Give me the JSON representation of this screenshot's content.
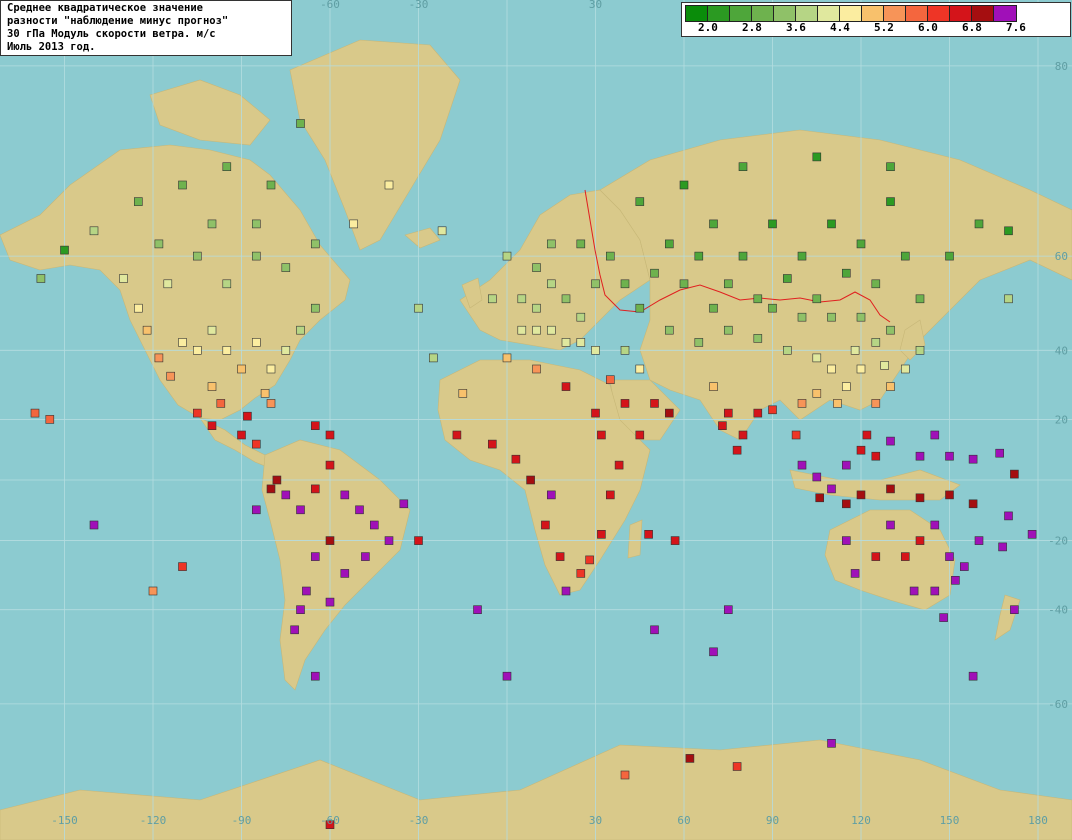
{
  "title": {
    "line1": "Среднее квадратическое значение",
    "line2": "разности \"наблюдение минус прогноз\"",
    "line3": "30 гПа Модуль скорости ветра. м/с",
    "line4": "Июль 2013 год."
  },
  "legend": {
    "colors": [
      "#0a8c0a",
      "#2b9a22",
      "#4ea63a",
      "#6eb24e",
      "#8fc168",
      "#b6d585",
      "#e0e89e",
      "#fbeda0",
      "#f8c16c",
      "#f79458",
      "#f4663e",
      "#ee3526",
      "#d4141a",
      "#a50e10",
      "#a010b8"
    ],
    "labels": [
      "2.0",
      "2.8",
      "3.6",
      "4.4",
      "5.2",
      "6.0",
      "6.8",
      "7.6"
    ]
  },
  "axis_labels": {
    "top_lon": [
      "-60",
      "-30",
      "30"
    ],
    "bottom_lon": [
      "-150",
      "-120",
      "-90",
      "-60",
      "-30",
      "30",
      "60",
      "90",
      "120",
      "150",
      "180"
    ],
    "right_lat": [
      "80",
      "60",
      "40",
      "20",
      "-20",
      "-40",
      "-60"
    ],
    "colors": {
      "ocean": "#8ccbd0",
      "land": "#d9c98a",
      "grid": "#b5dde0",
      "border": "#e02020"
    }
  },
  "stations": [
    {
      "lon": -158,
      "lat": 56,
      "c": 4
    },
    {
      "lon": -150,
      "lat": 61,
      "c": 1
    },
    {
      "lon": -140,
      "lat": 64,
      "c": 5
    },
    {
      "lon": -130,
      "lat": 56,
      "c": 6
    },
    {
      "lon": -125,
      "lat": 50,
      "c": 7
    },
    {
      "lon": -122,
      "lat": 45,
      "c": 8
    },
    {
      "lon": -118,
      "lat": 38,
      "c": 9
    },
    {
      "lon": -114,
      "lat": 33,
      "c": 9
    },
    {
      "lon": -110,
      "lat": 42,
      "c": 7
    },
    {
      "lon": -105,
      "lat": 40,
      "c": 7
    },
    {
      "lon": -100,
      "lat": 45,
      "c": 6
    },
    {
      "lon": -95,
      "lat": 40,
      "c": 7
    },
    {
      "lon": -90,
      "lat": 35,
      "c": 8
    },
    {
      "lon": -85,
      "lat": 42,
      "c": 7
    },
    {
      "lon": -80,
      "lat": 35,
      "c": 7
    },
    {
      "lon": -75,
      "lat": 40,
      "c": 6
    },
    {
      "lon": -70,
      "lat": 45,
      "c": 5
    },
    {
      "lon": -65,
      "lat": 50,
      "c": 4
    },
    {
      "lon": -95,
      "lat": 55,
      "c": 5
    },
    {
      "lon": -105,
      "lat": 60,
      "c": 4
    },
    {
      "lon": -85,
      "lat": 60,
      "c": 4
    },
    {
      "lon": -75,
      "lat": 58,
      "c": 4
    },
    {
      "lon": -115,
      "lat": 55,
      "c": 6
    },
    {
      "lon": -100,
      "lat": 30,
      "c": 8
    },
    {
      "lon": -97,
      "lat": 25,
      "c": 10
    },
    {
      "lon": -105,
      "lat": 22,
      "c": 11
    },
    {
      "lon": -100,
      "lat": 18,
      "c": 12
    },
    {
      "lon": -90,
      "lat": 15,
      "c": 12
    },
    {
      "lon": -88,
      "lat": 21,
      "c": 12
    },
    {
      "lon": -85,
      "lat": 12,
      "c": 11
    },
    {
      "lon": -80,
      "lat": 25,
      "c": 9
    },
    {
      "lon": -82,
      "lat": 28,
      "c": 8
    },
    {
      "lon": -65,
      "lat": 18,
      "c": 12
    },
    {
      "lon": -60,
      "lat": 15,
      "c": 12
    },
    {
      "lon": -155,
      "lat": 20,
      "c": 10
    },
    {
      "lon": -160,
      "lat": 22,
      "c": 10
    },
    {
      "lon": -78,
      "lat": 0,
      "c": 13
    },
    {
      "lon": -75,
      "lat": -5,
      "c": 14
    },
    {
      "lon": -70,
      "lat": -10,
      "c": 14
    },
    {
      "lon": -65,
      "lat": -3,
      "c": 12
    },
    {
      "lon": -60,
      "lat": 5,
      "c": 12
    },
    {
      "lon": -55,
      "lat": -5,
      "c": 14
    },
    {
      "lon": -50,
      "lat": -10,
      "c": 14
    },
    {
      "lon": -45,
      "lat": -15,
      "c": 14
    },
    {
      "lon": -40,
      "lat": -20,
      "c": 14
    },
    {
      "lon": -48,
      "lat": -25,
      "c": 14
    },
    {
      "lon": -55,
      "lat": -30,
      "c": 14
    },
    {
      "lon": -60,
      "lat": -20,
      "c": 13
    },
    {
      "lon": -65,
      "lat": -25,
      "c": 14
    },
    {
      "lon": -68,
      "lat": -35,
      "c": 14
    },
    {
      "lon": -70,
      "lat": -40,
      "c": 14
    },
    {
      "lon": -72,
      "lat": -45,
      "c": 14
    },
    {
      "lon": -60,
      "lat": -38,
      "c": 14
    },
    {
      "lon": -65,
      "lat": -55,
      "c": 14
    },
    {
      "lon": -35,
      "lat": -8,
      "c": 14
    },
    {
      "lon": -30,
      "lat": -20,
      "c": 12
    },
    {
      "lon": -80,
      "lat": -3,
      "c": 13
    },
    {
      "lon": -85,
      "lat": -10,
      "c": 14
    },
    {
      "lon": -110,
      "lat": -28,
      "c": 11
    },
    {
      "lon": -140,
      "lat": -15,
      "c": 14
    },
    {
      "lon": -120,
      "lat": -35,
      "c": 9
    },
    {
      "lon": -60,
      "lat": -75,
      "c": 12
    },
    {
      "lon": -52,
      "lat": 65,
      "c": 7
    },
    {
      "lon": -40,
      "lat": 70,
      "c": 7
    },
    {
      "lon": -22,
      "lat": 64,
      "c": 6
    },
    {
      "lon": -70,
      "lat": 76,
      "c": 3
    },
    {
      "lon": -30,
      "lat": 50,
      "c": 5
    },
    {
      "lon": -25,
      "lat": 38,
      "c": 5
    },
    {
      "lon": -15,
      "lat": 28,
      "c": 8
    },
    {
      "lon": -17,
      "lat": 15,
      "c": 12
    },
    {
      "lon": -5,
      "lat": 12,
      "c": 12
    },
    {
      "lon": 3,
      "lat": 7,
      "c": 12
    },
    {
      "lon": 8,
      "lat": 0,
      "c": 13
    },
    {
      "lon": 15,
      "lat": -5,
      "c": 14
    },
    {
      "lon": 13,
      "lat": -15,
      "c": 12
    },
    {
      "lon": 18,
      "lat": -25,
      "c": 12
    },
    {
      "lon": 25,
      "lat": -30,
      "c": 11
    },
    {
      "lon": 28,
      "lat": -26,
      "c": 11
    },
    {
      "lon": 32,
      "lat": -18,
      "c": 12
    },
    {
      "lon": 35,
      "lat": -5,
      "c": 12
    },
    {
      "lon": 38,
      "lat": 5,
      "c": 12
    },
    {
      "lon": 32,
      "lat": 15,
      "c": 12
    },
    {
      "lon": 30,
      "lat": 22,
      "c": 12
    },
    {
      "lon": 40,
      "lat": 25,
      "c": 12
    },
    {
      "lon": 45,
      "lat": 15,
      "c": 12
    },
    {
      "lon": 50,
      "lat": 25,
      "c": 12
    },
    {
      "lon": 55,
      "lat": 22,
      "c": 13
    },
    {
      "lon": 48,
      "lat": -18,
      "c": 12
    },
    {
      "lon": 57,
      "lat": -20,
      "c": 12
    },
    {
      "lon": 20,
      "lat": 30,
      "c": 12
    },
    {
      "lon": 10,
      "lat": 35,
      "c": 9
    },
    {
      "lon": 0,
      "lat": 38,
      "c": 8
    },
    {
      "lon": 5,
      "lat": 45,
      "c": 6
    },
    {
      "lon": 10,
      "lat": 50,
      "c": 5
    },
    {
      "lon": 15,
      "lat": 55,
      "c": 5
    },
    {
      "lon": 20,
      "lat": 52,
      "c": 4
    },
    {
      "lon": 25,
      "lat": 48,
      "c": 5
    },
    {
      "lon": 30,
      "lat": 55,
      "c": 4
    },
    {
      "lon": 35,
      "lat": 60,
      "c": 3
    },
    {
      "lon": 25,
      "lat": 62,
      "c": 3
    },
    {
      "lon": 15,
      "lat": 62,
      "c": 4
    },
    {
      "lon": 10,
      "lat": 58,
      "c": 4
    },
    {
      "lon": 40,
      "lat": 55,
      "c": 3
    },
    {
      "lon": 45,
      "lat": 50,
      "c": 3
    },
    {
      "lon": 50,
      "lat": 57,
      "c": 3
    },
    {
      "lon": 55,
      "lat": 62,
      "c": 2
    },
    {
      "lon": 60,
      "lat": 55,
      "c": 3
    },
    {
      "lon": 65,
      "lat": 60,
      "c": 2
    },
    {
      "lon": 70,
      "lat": 65,
      "c": 2
    },
    {
      "lon": 75,
      "lat": 55,
      "c": 3
    },
    {
      "lon": 80,
      "lat": 60,
      "c": 2
    },
    {
      "lon": 85,
      "lat": 52,
      "c": 3
    },
    {
      "lon": 90,
      "lat": 65,
      "c": 1
    },
    {
      "lon": 95,
      "lat": 56,
      "c": 2
    },
    {
      "lon": 100,
      "lat": 60,
      "c": 2
    },
    {
      "lon": 105,
      "lat": 52,
      "c": 3
    },
    {
      "lon": 110,
      "lat": 65,
      "c": 1
    },
    {
      "lon": 115,
      "lat": 57,
      "c": 2
    },
    {
      "lon": 120,
      "lat": 62,
      "c": 2
    },
    {
      "lon": 125,
      "lat": 55,
      "c": 3
    },
    {
      "lon": 130,
      "lat": 68,
      "c": 1
    },
    {
      "lon": 135,
      "lat": 60,
      "c": 2
    },
    {
      "lon": 140,
      "lat": 52,
      "c": 3
    },
    {
      "lon": 150,
      "lat": 60,
      "c": 2
    },
    {
      "lon": 160,
      "lat": 65,
      "c": 2
    },
    {
      "lon": 170,
      "lat": 64,
      "c": 1
    },
    {
      "lon": 45,
      "lat": 68,
      "c": 2
    },
    {
      "lon": 60,
      "lat": 70,
      "c": 1
    },
    {
      "lon": 80,
      "lat": 72,
      "c": 2
    },
    {
      "lon": 105,
      "lat": 73,
      "c": 1
    },
    {
      "lon": 130,
      "lat": 72,
      "c": 2
    },
    {
      "lon": 55,
      "lat": 45,
      "c": 4
    },
    {
      "lon": 65,
      "lat": 42,
      "c": 4
    },
    {
      "lon": 75,
      "lat": 45,
      "c": 4
    },
    {
      "lon": 85,
      "lat": 43,
      "c": 4
    },
    {
      "lon": 95,
      "lat": 40,
      "c": 5
    },
    {
      "lon": 105,
      "lat": 38,
      "c": 6
    },
    {
      "lon": 110,
      "lat": 35,
      "c": 7
    },
    {
      "lon": 115,
      "lat": 30,
      "c": 7
    },
    {
      "lon": 120,
      "lat": 35,
      "c": 7
    },
    {
      "lon": 112,
      "lat": 25,
      "c": 8
    },
    {
      "lon": 105,
      "lat": 28,
      "c": 8
    },
    {
      "lon": 100,
      "lat": 25,
      "c": 9
    },
    {
      "lon": 118,
      "lat": 40,
      "c": 6
    },
    {
      "lon": 125,
      "lat": 42,
      "c": 5
    },
    {
      "lon": 128,
      "lat": 36,
      "c": 6
    },
    {
      "lon": 135,
      "lat": 35,
      "c": 6
    },
    {
      "lon": 140,
      "lat": 40,
      "c": 5
    },
    {
      "lon": 130,
      "lat": 30,
      "c": 8
    },
    {
      "lon": 125,
      "lat": 25,
      "c": 9
    },
    {
      "lon": 70,
      "lat": 30,
      "c": 8
    },
    {
      "lon": 75,
      "lat": 22,
      "c": 12
    },
    {
      "lon": 80,
      "lat": 15,
      "c": 12
    },
    {
      "lon": 85,
      "lat": 22,
      "c": 12
    },
    {
      "lon": 78,
      "lat": 10,
      "c": 12
    },
    {
      "lon": 73,
      "lat": 18,
      "c": 12
    },
    {
      "lon": 90,
      "lat": 23,
      "c": 11
    },
    {
      "lon": 98,
      "lat": 15,
      "c": 11
    },
    {
      "lon": 100,
      "lat": 5,
      "c": 14
    },
    {
      "lon": 105,
      "lat": 1,
      "c": 14
    },
    {
      "lon": 110,
      "lat": -3,
      "c": 14
    },
    {
      "lon": 115,
      "lat": 5,
      "c": 14
    },
    {
      "lon": 120,
      "lat": 10,
      "c": 12
    },
    {
      "lon": 122,
      "lat": 15,
      "c": 12
    },
    {
      "lon": 125,
      "lat": 8,
      "c": 12
    },
    {
      "lon": 130,
      "lat": 13,
      "c": 14
    },
    {
      "lon": 140,
      "lat": 8,
      "c": 14
    },
    {
      "lon": 145,
      "lat": 15,
      "c": 14
    },
    {
      "lon": 150,
      "lat": 8,
      "c": 14
    },
    {
      "lon": 158,
      "lat": 7,
      "c": 14
    },
    {
      "lon": 167,
      "lat": 9,
      "c": 14
    },
    {
      "lon": 172,
      "lat": 2,
      "c": 13
    },
    {
      "lon": 106,
      "lat": -6,
      "c": 13
    },
    {
      "lon": 115,
      "lat": -8,
      "c": 13
    },
    {
      "lon": 120,
      "lat": -5,
      "c": 13
    },
    {
      "lon": 130,
      "lat": -3,
      "c": 13
    },
    {
      "lon": 140,
      "lat": -6,
      "c": 13
    },
    {
      "lon": 150,
      "lat": -5,
      "c": 13
    },
    {
      "lon": 158,
      "lat": -8,
      "c": 13
    },
    {
      "lon": 170,
      "lat": -12,
      "c": 14
    },
    {
      "lon": 178,
      "lat": -18,
      "c": 14
    },
    {
      "lon": 160,
      "lat": -20,
      "c": 14
    },
    {
      "lon": 168,
      "lat": -22,
      "c": 14
    },
    {
      "lon": 115,
      "lat": -20,
      "c": 14
    },
    {
      "lon": 118,
      "lat": -30,
      "c": 14
    },
    {
      "lon": 125,
      "lat": -25,
      "c": 12
    },
    {
      "lon": 130,
      "lat": -15,
      "c": 14
    },
    {
      "lon": 135,
      "lat": -25,
      "c": 12
    },
    {
      "lon": 140,
      "lat": -20,
      "c": 12
    },
    {
      "lon": 145,
      "lat": -15,
      "c": 14
    },
    {
      "lon": 150,
      "lat": -25,
      "c": 14
    },
    {
      "lon": 145,
      "lat": -35,
      "c": 14
    },
    {
      "lon": 138,
      "lat": -35,
      "c": 14
    },
    {
      "lon": 148,
      "lat": -42,
      "c": 14
    },
    {
      "lon": 152,
      "lat": -32,
      "c": 14
    },
    {
      "lon": 155,
      "lat": -28,
      "c": 14
    },
    {
      "lon": 172,
      "lat": -40,
      "c": 14
    },
    {
      "lon": 158,
      "lat": -55,
      "c": 14
    },
    {
      "lon": 75,
      "lat": -40,
      "c": 14
    },
    {
      "lon": 70,
      "lat": -50,
      "c": 14
    },
    {
      "lon": 50,
      "lat": -45,
      "c": 14
    },
    {
      "lon": -10,
      "lat": -40,
      "c": 14
    },
    {
      "lon": 0,
      "lat": -55,
      "c": 14
    },
    {
      "lon": 20,
      "lat": -35,
      "c": 14
    },
    {
      "lon": 62,
      "lat": -68,
      "c": 13
    },
    {
      "lon": 78,
      "lat": -69,
      "c": 11
    },
    {
      "lon": 110,
      "lat": -66,
      "c": 14
    },
    {
      "lon": 40,
      "lat": -70,
      "c": 10
    },
    {
      "lon": 0,
      "lat": 60,
      "c": 5
    },
    {
      "lon": -5,
      "lat": 52,
      "c": 5
    },
    {
      "lon": 5,
      "lat": 52,
      "c": 5
    },
    {
      "lon": 20,
      "lat": 42,
      "c": 6
    },
    {
      "lon": 30,
      "lat": 40,
      "c": 6
    },
    {
      "lon": 40,
      "lat": 40,
      "c": 5
    },
    {
      "lon": 45,
      "lat": 35,
      "c": 7
    },
    {
      "lon": 35,
      "lat": 32,
      "c": 10
    },
    {
      "lon": 10,
      "lat": 45,
      "c": 6
    },
    {
      "lon": 15,
      "lat": 45,
      "c": 6
    },
    {
      "lon": 25,
      "lat": 42,
      "c": 6
    },
    {
      "lon": 70,
      "lat": 50,
      "c": 3
    },
    {
      "lon": 90,
      "lat": 50,
      "c": 3
    },
    {
      "lon": 100,
      "lat": 48,
      "c": 4
    },
    {
      "lon": 110,
      "lat": 48,
      "c": 4
    },
    {
      "lon": 120,
      "lat": 48,
      "c": 4
    },
    {
      "lon": 130,
      "lat": 45,
      "c": 4
    },
    {
      "lon": 170,
      "lat": 52,
      "c": 5
    },
    {
      "lon": -80,
      "lat": 70,
      "c": 3
    },
    {
      "lon": -95,
      "lat": 72,
      "c": 3
    },
    {
      "lon": -110,
      "lat": 70,
      "c": 3
    },
    {
      "lon": -125,
      "lat": 68,
      "c": 3
    },
    {
      "lon": -85,
      "lat": 65,
      "c": 4
    },
    {
      "lon": -100,
      "lat": 65,
      "c": 4
    },
    {
      "lon": -118,
      "lat": 62,
      "c": 4
    },
    {
      "lon": -65,
      "lat": 62,
      "c": 4
    }
  ]
}
